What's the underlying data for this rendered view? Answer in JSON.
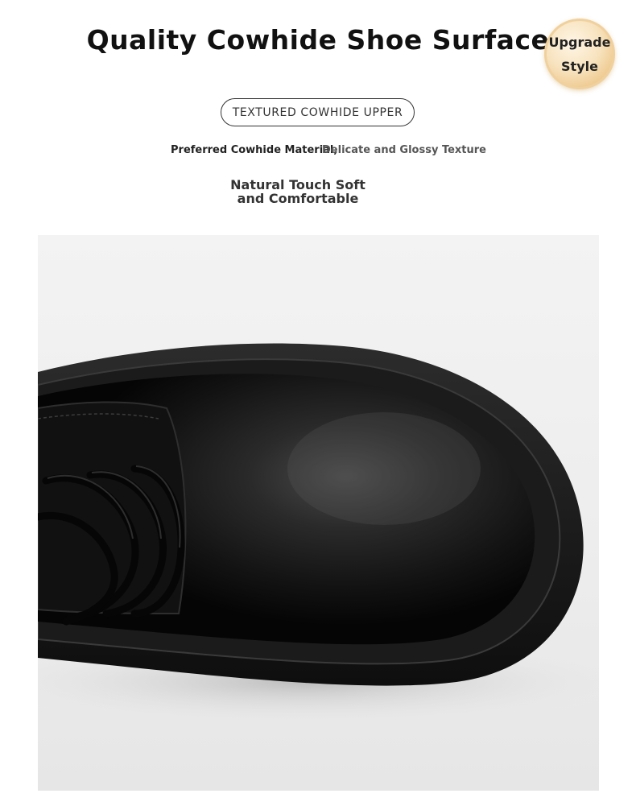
{
  "header": {
    "title": "Quality Cowhide Shoe Surface",
    "badge_line1": "Upgrade",
    "badge_line2": "Style"
  },
  "feature": {
    "pill_label": "TEXTURED COWHIDE UPPER",
    "subline_left": "Preferred Cowhide Material,",
    "subline_right": "Delicate and Glossy Texture",
    "soft_line1": "Natural Touch Soft",
    "soft_line2": "and Comfortable"
  },
  "colors": {
    "leather": "#0d0d0d",
    "sole": "#1a1a1a",
    "background": "#ededed",
    "badge_gold": "#e3b069"
  },
  "image": {
    "subject": "shoe-photo"
  }
}
